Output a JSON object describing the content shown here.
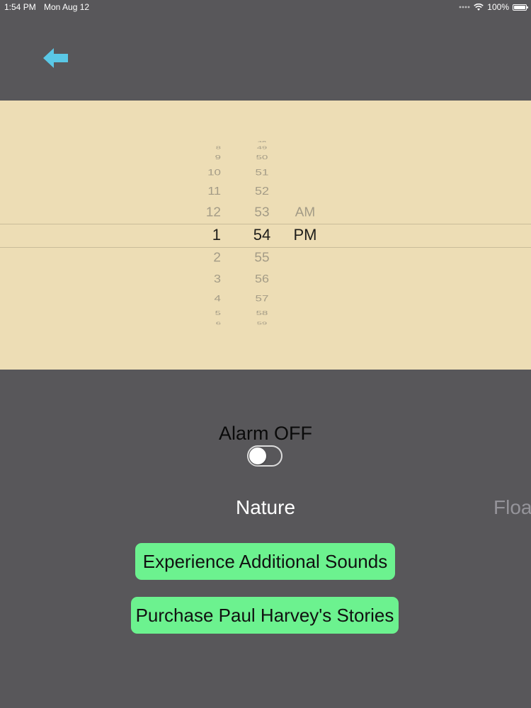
{
  "status_bar": {
    "time": "1:54 PM",
    "date": "Mon Aug 12",
    "battery": "100%"
  },
  "back_button": {
    "icon": "back-arrow-icon",
    "color": "#5ac8e6"
  },
  "time_picker": {
    "hours": [
      "8",
      "9",
      "10",
      "11",
      "12",
      "1",
      "2",
      "3",
      "4",
      "5",
      "6"
    ],
    "minutes": [
      "48",
      "49",
      "50",
      "51",
      "52",
      "53",
      "54",
      "55",
      "56",
      "57",
      "58",
      "59"
    ],
    "periods": [
      "AM",
      "PM"
    ],
    "selected_hour": "1",
    "selected_minute": "54",
    "selected_period": "PM"
  },
  "alarm": {
    "label": "Alarm OFF",
    "enabled": false
  },
  "sound_selector": {
    "current": "Nature",
    "next_partial": "Floa"
  },
  "buttons": {
    "additional_sounds": "Experience Additional Sounds",
    "paul_harvey": "Purchase Paul Harvey's Stories"
  },
  "colors": {
    "background": "#58575a",
    "picker_background": "#edddb5",
    "button_green": "#6cf28f",
    "accent_blue": "#5ac8e6"
  }
}
